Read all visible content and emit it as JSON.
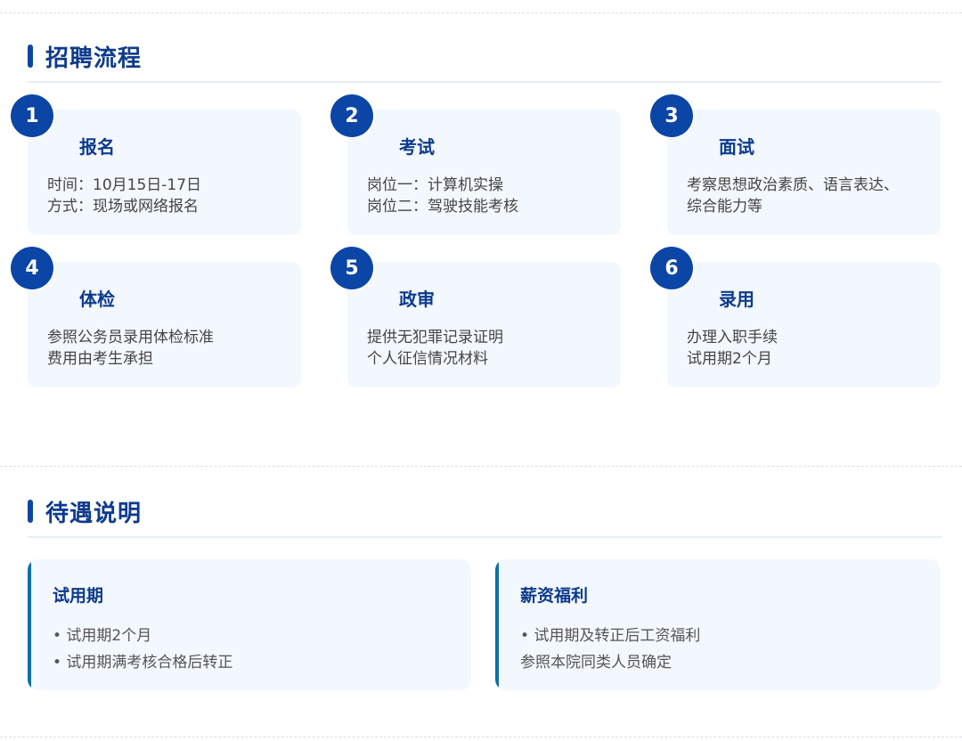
{
  "process": {
    "title": "招聘流程",
    "steps": [
      {
        "num": "1",
        "title": "报名",
        "lines": [
          "时间：10月15日-17日",
          "方式：现场或网络报名"
        ]
      },
      {
        "num": "2",
        "title": "考试",
        "lines": [
          "岗位一：计算机实操",
          "岗位二：驾驶技能考核"
        ]
      },
      {
        "num": "3",
        "title": "面试",
        "lines": [
          "考察思想政治素质、语言表达、",
          "综合能力等"
        ]
      },
      {
        "num": "4",
        "title": "体检",
        "lines": [
          "参照公务员录用体检标准",
          "费用由考生承担"
        ]
      },
      {
        "num": "5",
        "title": "政审",
        "lines": [
          "提供无犯罪记录证明",
          "个人征信情况材料"
        ]
      },
      {
        "num": "6",
        "title": "录用",
        "lines": [
          "办理入职手续",
          "试用期2个月"
        ]
      }
    ]
  },
  "benefits": {
    "title": "待遇说明",
    "cards": [
      {
        "title": "试用期",
        "lines": [
          "• 试用期2个月",
          "• 试用期满考核合格后转正"
        ]
      },
      {
        "title": "薪资福利",
        "lines": [
          "• 试用期及转正后工资福利",
          "参照本院同类人员确定"
        ]
      }
    ]
  },
  "colors": {
    "accent": "#0b45a6",
    "heading": "#0d3b8c",
    "card_bg": "#f3f7fe",
    "edge": "#0f6fa6"
  }
}
